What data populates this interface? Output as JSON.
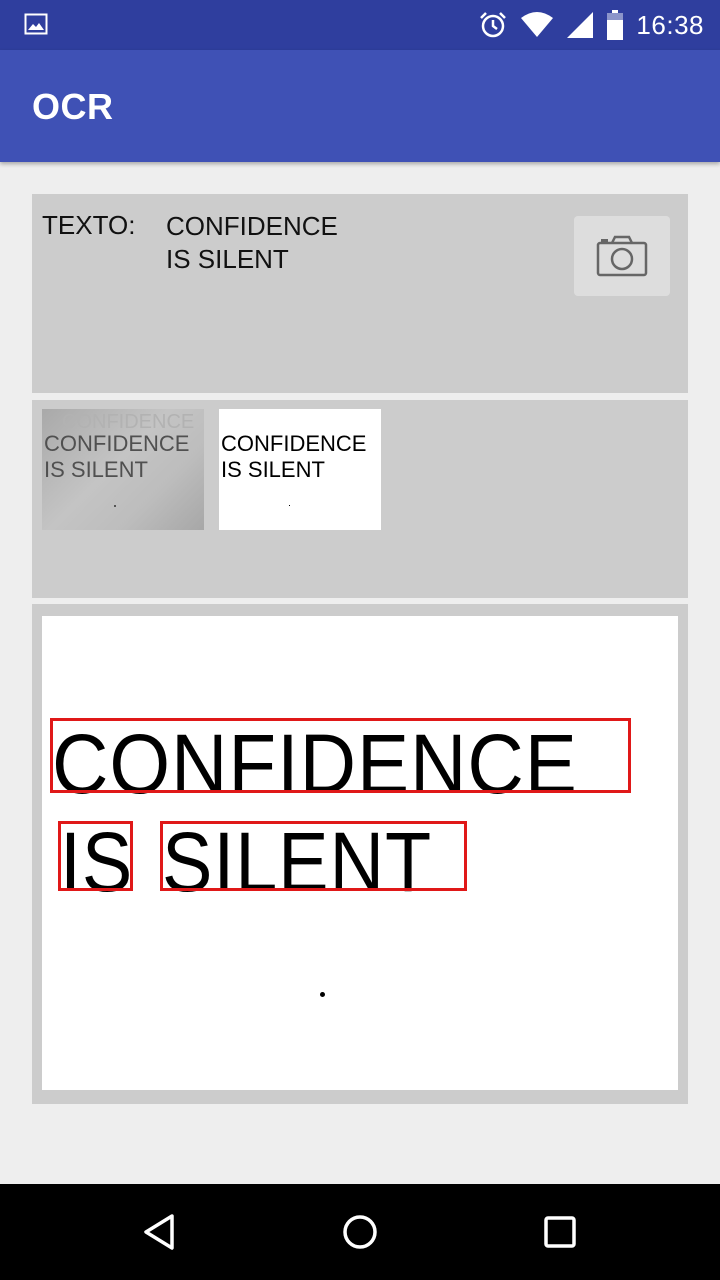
{
  "status_bar": {
    "time": "16:38",
    "icons": [
      "image-notification-icon",
      "alarm-icon",
      "wifi-icon",
      "signal-icon",
      "battery-icon"
    ]
  },
  "app_bar": {
    "title": "OCR"
  },
  "text_panel": {
    "label": "TEXTO:",
    "value": "CONFIDENCE\nIS SILENT",
    "camera_button_icon": "camera-icon"
  },
  "thumbnails": [
    {
      "kind": "original-grayscale",
      "text": "CONFIDENCE\nIS SILENT"
    },
    {
      "kind": "binarized",
      "text": "CONFIDENCE\nIS SILENT"
    }
  ],
  "result_image": {
    "line1": "CONFIDENCE",
    "line2_word1": "IS",
    "line2_word2": "SILENT",
    "box_color": "#e01818"
  },
  "nav_bar": {
    "buttons": [
      "back-icon",
      "home-icon",
      "recents-icon"
    ]
  },
  "colors": {
    "status_bar": "#2f3e9e",
    "app_bar": "#3f51b5",
    "panel": "#cccccc",
    "background": "#eeeeee"
  }
}
